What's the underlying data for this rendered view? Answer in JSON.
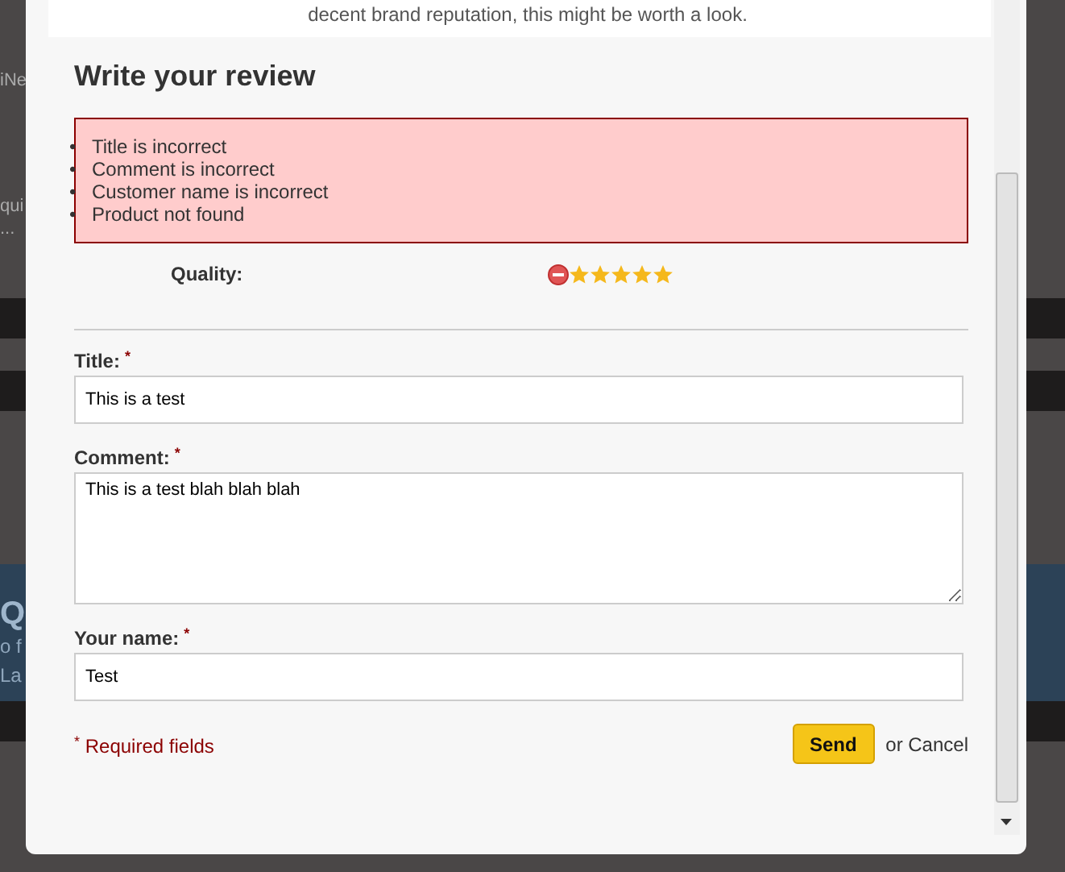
{
  "background_fragments": [
    {
      "text": "iNe",
      "kind": "plain"
    },
    {
      "text": "qui",
      "kind": "plain"
    },
    {
      "text": "...",
      "kind": "plain"
    },
    {
      "text": "Q",
      "kind": "banner-title"
    },
    {
      "text": "o f",
      "kind": "banner-text"
    },
    {
      "text": "La",
      "kind": "banner-text"
    }
  ],
  "dialog": {
    "excerpt": "decent brand reputation, this might be worth a look.",
    "heading": "Write your review",
    "errors": [
      {
        "bullet": "•",
        "text": "Title is incorrect"
      },
      {
        "bullet": "•",
        "text": "Comment is incorrect"
      },
      {
        "bullet": "•",
        "text": "Customer name is incorrect"
      },
      {
        "bullet": "•",
        "text": "Product not found"
      }
    ],
    "rating": {
      "label": "Quality:",
      "stars": 5
    },
    "fields": [
      {
        "kind": "input",
        "label": "Title:",
        "required_mark": "*",
        "value": "This is a test"
      },
      {
        "kind": "textarea",
        "label": "Comment:",
        "required_mark": "*",
        "value": "This is a test blah blah blah"
      },
      {
        "kind": "input",
        "label": "Your name:",
        "required_mark": "*",
        "value": "Test"
      }
    ],
    "required_note": {
      "mark": "*",
      "text": "Required fields"
    },
    "send_button": "Send",
    "cancel_link": "or Cancel"
  }
}
